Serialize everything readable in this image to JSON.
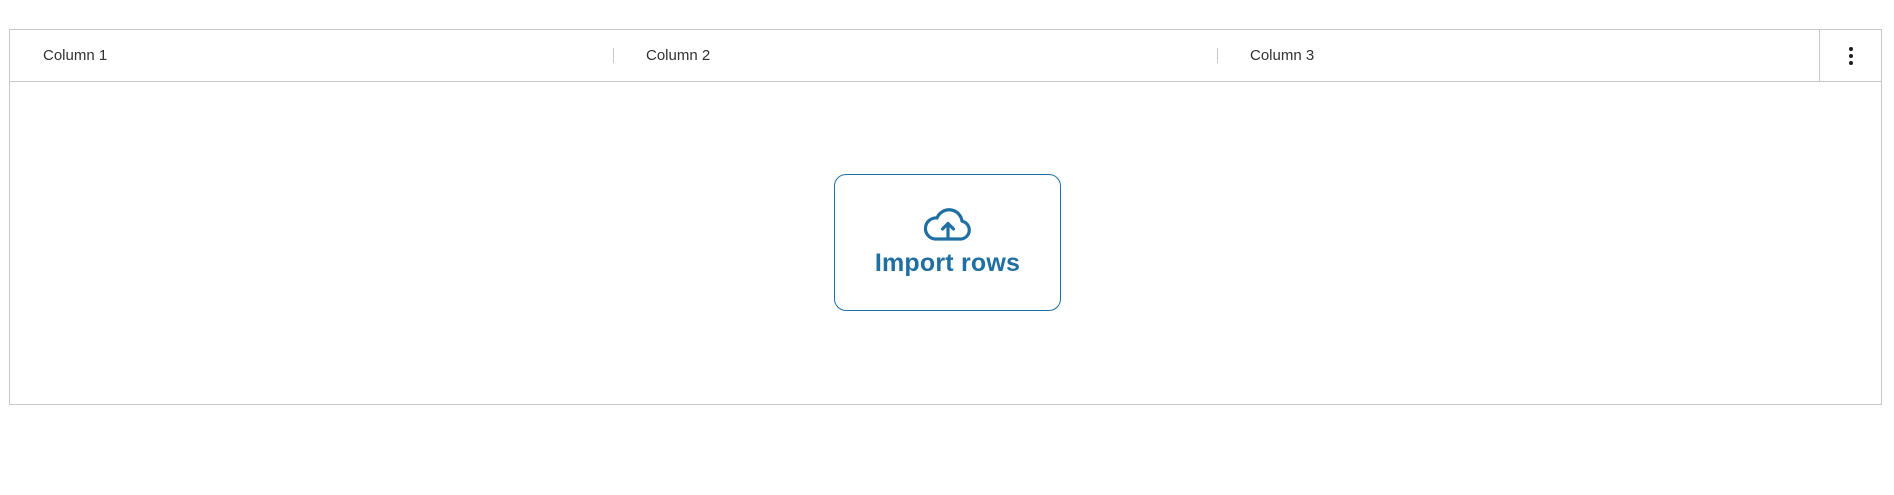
{
  "grid": {
    "columns": [
      {
        "label": "Column 1"
      },
      {
        "label": "Column 2"
      },
      {
        "label": "Column 3"
      }
    ],
    "menu_icon": "more-vertical-icon"
  },
  "empty_state": {
    "import_label": "Import rows",
    "icon": "cloud-upload-icon",
    "accent_color": "#1f6fa3"
  }
}
